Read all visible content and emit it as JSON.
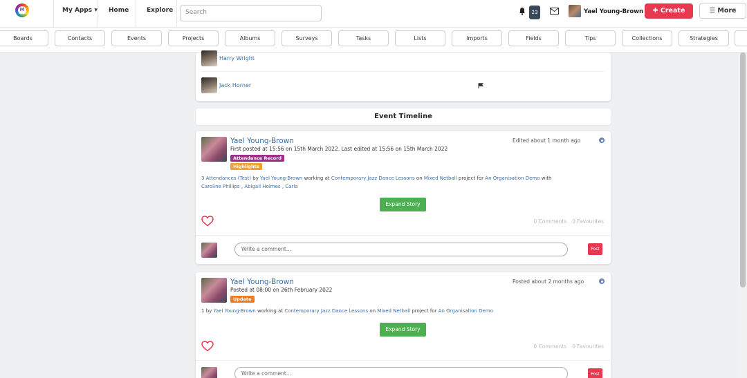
{
  "topnav": {
    "logo_letter": "M",
    "my_apps": "My Apps",
    "home": "Home",
    "explore": "Explore",
    "search_placeholder": "Search",
    "notification_count": "23",
    "user_name": "Yael Young-Brown",
    "create": "Create",
    "more": "More"
  },
  "categories": [
    "Boards",
    "Contacts",
    "Events",
    "Projects",
    "Albums",
    "Surveys",
    "Tasks",
    "Lists",
    "Imports",
    "Fields",
    "Tips",
    "Collections",
    "Strategies"
  ],
  "attendees": [
    {
      "name": "Harry Wright"
    },
    {
      "name": "Jack Horner"
    }
  ],
  "timeline": {
    "title": "Event Timeline",
    "posts": [
      {
        "author": "Yael Young-Brown",
        "posted": "First posted at 15:56 on 15th March 2022. Last edited at 15:56 on 15th March 2022",
        "tags": [
          {
            "label": "Attendance Record",
            "color": "#9c2f8a"
          },
          {
            "label": "Highlights",
            "color": "#f0a030"
          }
        ],
        "edited": "Edited about 1 month ago",
        "story": {
          "count": "3 Attendances (Test)",
          "by": "by",
          "user": "Yael Young-Brown",
          "working_at": "working at",
          "venue": "Contemporary Jazz Dance Lessons",
          "on": "on",
          "project": "Mixed Netball",
          "project_for": "project for",
          "org": "An Organisation Demo",
          "with": "with",
          "people_1": "Caroline Phillips",
          "sep_1": ",",
          "people_2": "Abigail Holmes",
          "sep_2": ",",
          "people_3": "Carla"
        },
        "expand": "Expand Story",
        "comments": "0 Comments",
        "favourites": "0 Favourites",
        "comment_placeholder": "Write a comment...",
        "post": "Post"
      },
      {
        "author": "Yael Young-Brown",
        "posted": "Posted at 08:00 on 26th February 2022",
        "tags": [
          {
            "label": "Update",
            "color": "#f07a20"
          }
        ],
        "edited": "Posted about 2 months ago",
        "story": {
          "count": "1",
          "by": "by",
          "user": "Yael Young-Brown",
          "working_at": "working at",
          "venue": "Contemporary Jazz Dance Lessons",
          "on": "on",
          "project": "Mixed Netball",
          "project_for": "project for",
          "org": "An Organisation Demo"
        },
        "expand": "Expand Story",
        "comments": "0 Comments",
        "favourites": "0 Favourites",
        "comment_placeholder": "Write a comment...",
        "post": "Post"
      }
    ]
  },
  "colors": {
    "accent_red": "#e63950",
    "link_blue": "#3a6ea5",
    "expand_green": "#4caf50"
  }
}
